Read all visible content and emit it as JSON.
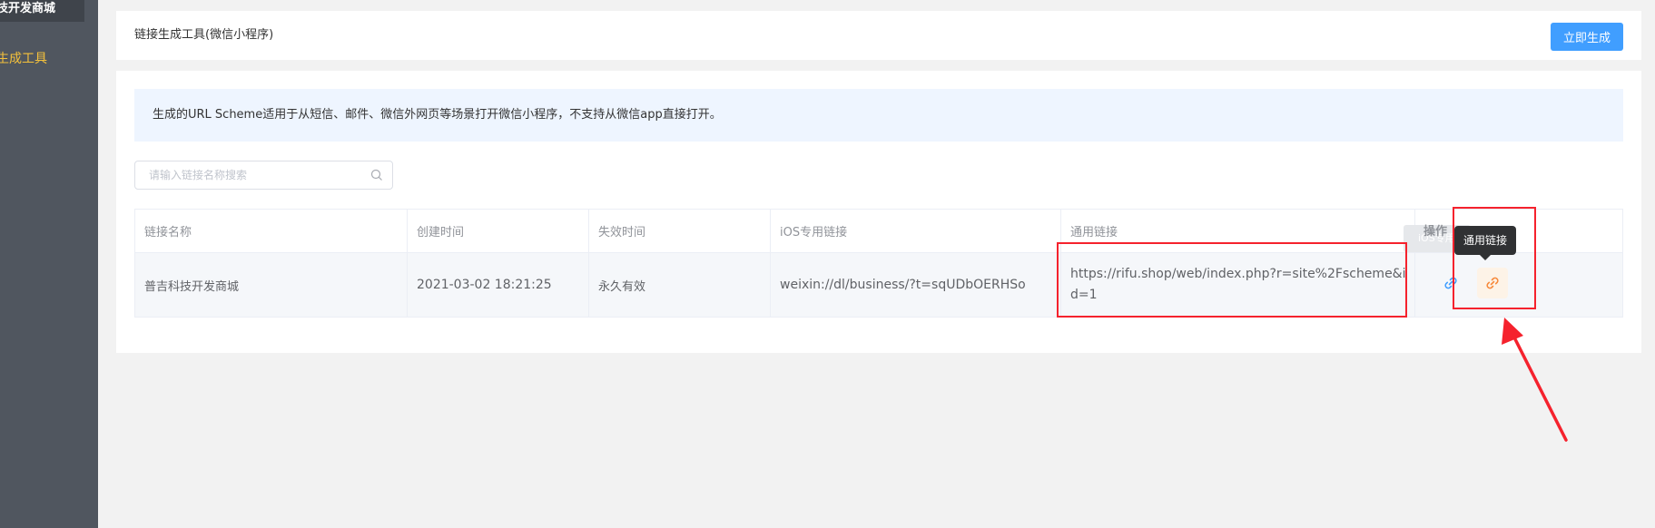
{
  "sidebar": {
    "top_label": "技开发商城",
    "active_item": "生成工具"
  },
  "header": {
    "title": "链接生成工具(微信小程序)",
    "generate_button": "立即生成"
  },
  "notice": {
    "text": "生成的URL Scheme适用于从短信、邮件、微信外网页等场景打开微信小程序，不支持从微信app直接打开。"
  },
  "search": {
    "placeholder": "请输入链接名称搜索",
    "icon": "search-icon"
  },
  "table": {
    "columns": [
      "链接名称",
      "创建时间",
      "失效时间",
      "iOS专用链接",
      "通用链接",
      "操作"
    ],
    "rows": [
      {
        "name": "普吉科技开发商城",
        "created": "2021-03-02 18:21:25",
        "expires": "永久有效",
        "ios_link": "weixin://dl/business/?t=sqUDbOERHSo",
        "general_link": "https://rifu.shop/web/index.php?r=site%2Fscheme&id=1"
      }
    ]
  },
  "tooltips": {
    "ios": "iOS专用",
    "general": "通用链接"
  },
  "colors": {
    "primary": "#409eff",
    "sidebar": "#50565f",
    "active": "#f5c13b",
    "annotation": "#f5222d",
    "general_icon": "#f7893b"
  }
}
